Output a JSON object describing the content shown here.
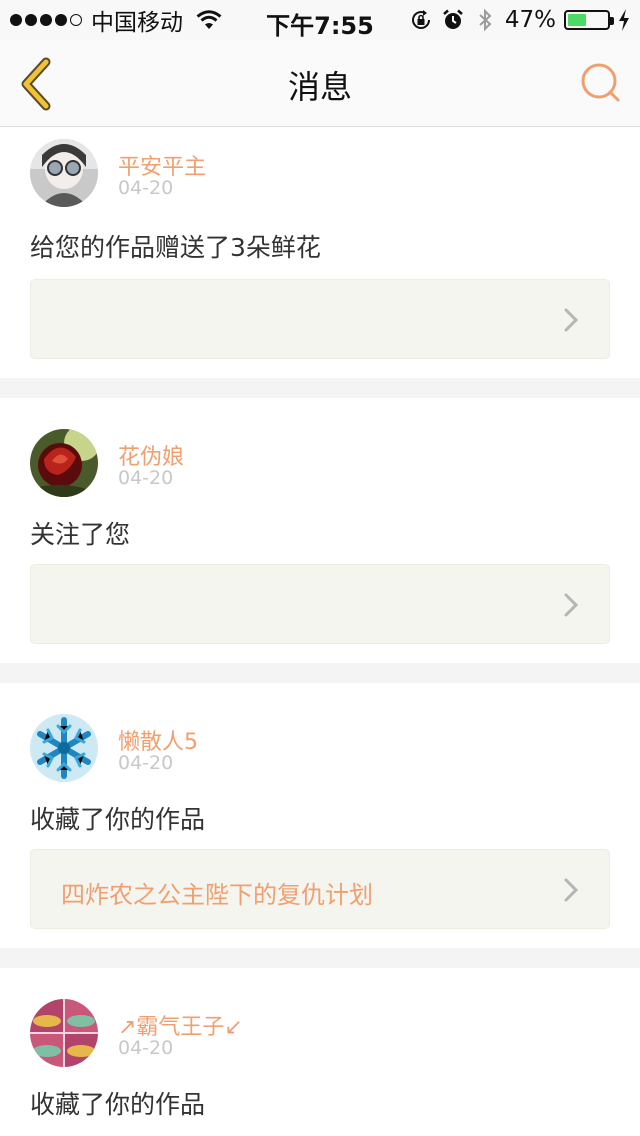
{
  "status_bar": {
    "carrier": "中国移动",
    "time": "下午7:55",
    "battery_percent": "47%",
    "battery_level": 0.47,
    "icons": [
      "signal-dots-icon",
      "wifi-icon",
      "rotation-lock-icon",
      "alarm-icon",
      "bluetooth-icon",
      "battery-icon",
      "charging-bolt-icon"
    ]
  },
  "nav": {
    "title": "消息",
    "back_icon": "chevron-left-icon",
    "search_icon": "search-icon"
  },
  "colors": {
    "accent": "#f0a070",
    "back_arrow": "#f1c232",
    "date": "#c8c8c8",
    "box_bg": "#f5f5ef"
  },
  "messages": [
    {
      "username": "平安平主",
      "date": "04-20",
      "text": "给您的作品赠送了3朵鲜花",
      "work_title": ""
    },
    {
      "username": "花伪娘",
      "date": "04-20",
      "text": "关注了您",
      "work_title": ""
    },
    {
      "username": "懒散人5",
      "date": "04-20",
      "text": "收藏了你的作品",
      "work_title": "四炸农之公主陛下的复仇计划"
    },
    {
      "username": "↗霸气王子↙",
      "date": "04-20",
      "text": "收藏了你的作品",
      "work_title": ""
    }
  ]
}
